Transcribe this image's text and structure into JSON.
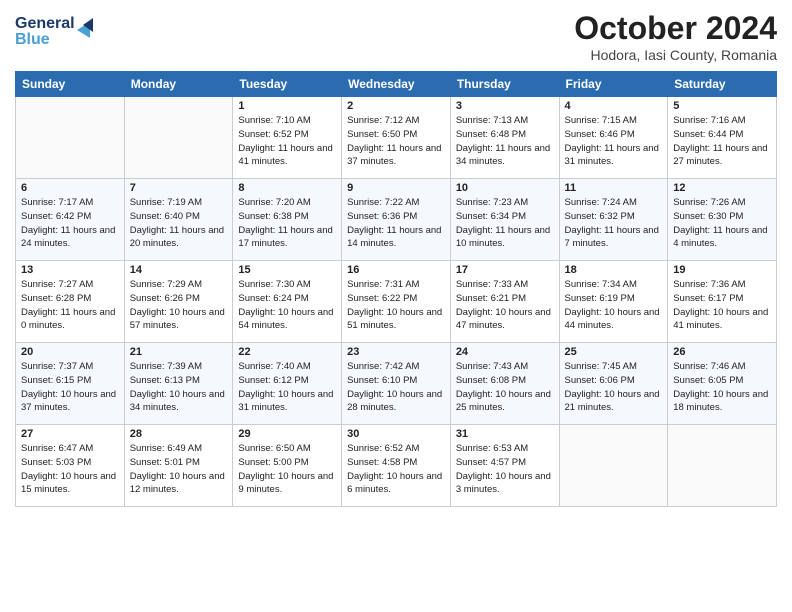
{
  "logo": {
    "line1": "General",
    "line2": "Blue"
  },
  "title": "October 2024",
  "location": "Hodora, Iasi County, Romania",
  "weekdays": [
    "Sunday",
    "Monday",
    "Tuesday",
    "Wednesday",
    "Thursday",
    "Friday",
    "Saturday"
  ],
  "weeks": [
    [
      {
        "day": "",
        "sunrise": "",
        "sunset": "",
        "daylight": ""
      },
      {
        "day": "",
        "sunrise": "",
        "sunset": "",
        "daylight": ""
      },
      {
        "day": "1",
        "sunrise": "Sunrise: 7:10 AM",
        "sunset": "Sunset: 6:52 PM",
        "daylight": "Daylight: 11 hours and 41 minutes."
      },
      {
        "day": "2",
        "sunrise": "Sunrise: 7:12 AM",
        "sunset": "Sunset: 6:50 PM",
        "daylight": "Daylight: 11 hours and 37 minutes."
      },
      {
        "day": "3",
        "sunrise": "Sunrise: 7:13 AM",
        "sunset": "Sunset: 6:48 PM",
        "daylight": "Daylight: 11 hours and 34 minutes."
      },
      {
        "day": "4",
        "sunrise": "Sunrise: 7:15 AM",
        "sunset": "Sunset: 6:46 PM",
        "daylight": "Daylight: 11 hours and 31 minutes."
      },
      {
        "day": "5",
        "sunrise": "Sunrise: 7:16 AM",
        "sunset": "Sunset: 6:44 PM",
        "daylight": "Daylight: 11 hours and 27 minutes."
      }
    ],
    [
      {
        "day": "6",
        "sunrise": "Sunrise: 7:17 AM",
        "sunset": "Sunset: 6:42 PM",
        "daylight": "Daylight: 11 hours and 24 minutes."
      },
      {
        "day": "7",
        "sunrise": "Sunrise: 7:19 AM",
        "sunset": "Sunset: 6:40 PM",
        "daylight": "Daylight: 11 hours and 20 minutes."
      },
      {
        "day": "8",
        "sunrise": "Sunrise: 7:20 AM",
        "sunset": "Sunset: 6:38 PM",
        "daylight": "Daylight: 11 hours and 17 minutes."
      },
      {
        "day": "9",
        "sunrise": "Sunrise: 7:22 AM",
        "sunset": "Sunset: 6:36 PM",
        "daylight": "Daylight: 11 hours and 14 minutes."
      },
      {
        "day": "10",
        "sunrise": "Sunrise: 7:23 AM",
        "sunset": "Sunset: 6:34 PM",
        "daylight": "Daylight: 11 hours and 10 minutes."
      },
      {
        "day": "11",
        "sunrise": "Sunrise: 7:24 AM",
        "sunset": "Sunset: 6:32 PM",
        "daylight": "Daylight: 11 hours and 7 minutes."
      },
      {
        "day": "12",
        "sunrise": "Sunrise: 7:26 AM",
        "sunset": "Sunset: 6:30 PM",
        "daylight": "Daylight: 11 hours and 4 minutes."
      }
    ],
    [
      {
        "day": "13",
        "sunrise": "Sunrise: 7:27 AM",
        "sunset": "Sunset: 6:28 PM",
        "daylight": "Daylight: 11 hours and 0 minutes."
      },
      {
        "day": "14",
        "sunrise": "Sunrise: 7:29 AM",
        "sunset": "Sunset: 6:26 PM",
        "daylight": "Daylight: 10 hours and 57 minutes."
      },
      {
        "day": "15",
        "sunrise": "Sunrise: 7:30 AM",
        "sunset": "Sunset: 6:24 PM",
        "daylight": "Daylight: 10 hours and 54 minutes."
      },
      {
        "day": "16",
        "sunrise": "Sunrise: 7:31 AM",
        "sunset": "Sunset: 6:22 PM",
        "daylight": "Daylight: 10 hours and 51 minutes."
      },
      {
        "day": "17",
        "sunrise": "Sunrise: 7:33 AM",
        "sunset": "Sunset: 6:21 PM",
        "daylight": "Daylight: 10 hours and 47 minutes."
      },
      {
        "day": "18",
        "sunrise": "Sunrise: 7:34 AM",
        "sunset": "Sunset: 6:19 PM",
        "daylight": "Daylight: 10 hours and 44 minutes."
      },
      {
        "day": "19",
        "sunrise": "Sunrise: 7:36 AM",
        "sunset": "Sunset: 6:17 PM",
        "daylight": "Daylight: 10 hours and 41 minutes."
      }
    ],
    [
      {
        "day": "20",
        "sunrise": "Sunrise: 7:37 AM",
        "sunset": "Sunset: 6:15 PM",
        "daylight": "Daylight: 10 hours and 37 minutes."
      },
      {
        "day": "21",
        "sunrise": "Sunrise: 7:39 AM",
        "sunset": "Sunset: 6:13 PM",
        "daylight": "Daylight: 10 hours and 34 minutes."
      },
      {
        "day": "22",
        "sunrise": "Sunrise: 7:40 AM",
        "sunset": "Sunset: 6:12 PM",
        "daylight": "Daylight: 10 hours and 31 minutes."
      },
      {
        "day": "23",
        "sunrise": "Sunrise: 7:42 AM",
        "sunset": "Sunset: 6:10 PM",
        "daylight": "Daylight: 10 hours and 28 minutes."
      },
      {
        "day": "24",
        "sunrise": "Sunrise: 7:43 AM",
        "sunset": "Sunset: 6:08 PM",
        "daylight": "Daylight: 10 hours and 25 minutes."
      },
      {
        "day": "25",
        "sunrise": "Sunrise: 7:45 AM",
        "sunset": "Sunset: 6:06 PM",
        "daylight": "Daylight: 10 hours and 21 minutes."
      },
      {
        "day": "26",
        "sunrise": "Sunrise: 7:46 AM",
        "sunset": "Sunset: 6:05 PM",
        "daylight": "Daylight: 10 hours and 18 minutes."
      }
    ],
    [
      {
        "day": "27",
        "sunrise": "Sunrise: 6:47 AM",
        "sunset": "Sunset: 5:03 PM",
        "daylight": "Daylight: 10 hours and 15 minutes."
      },
      {
        "day": "28",
        "sunrise": "Sunrise: 6:49 AM",
        "sunset": "Sunset: 5:01 PM",
        "daylight": "Daylight: 10 hours and 12 minutes."
      },
      {
        "day": "29",
        "sunrise": "Sunrise: 6:50 AM",
        "sunset": "Sunset: 5:00 PM",
        "daylight": "Daylight: 10 hours and 9 minutes."
      },
      {
        "day": "30",
        "sunrise": "Sunrise: 6:52 AM",
        "sunset": "Sunset: 4:58 PM",
        "daylight": "Daylight: 10 hours and 6 minutes."
      },
      {
        "day": "31",
        "sunrise": "Sunrise: 6:53 AM",
        "sunset": "Sunset: 4:57 PM",
        "daylight": "Daylight: 10 hours and 3 minutes."
      },
      {
        "day": "",
        "sunrise": "",
        "sunset": "",
        "daylight": ""
      },
      {
        "day": "",
        "sunrise": "",
        "sunset": "",
        "daylight": ""
      }
    ]
  ]
}
